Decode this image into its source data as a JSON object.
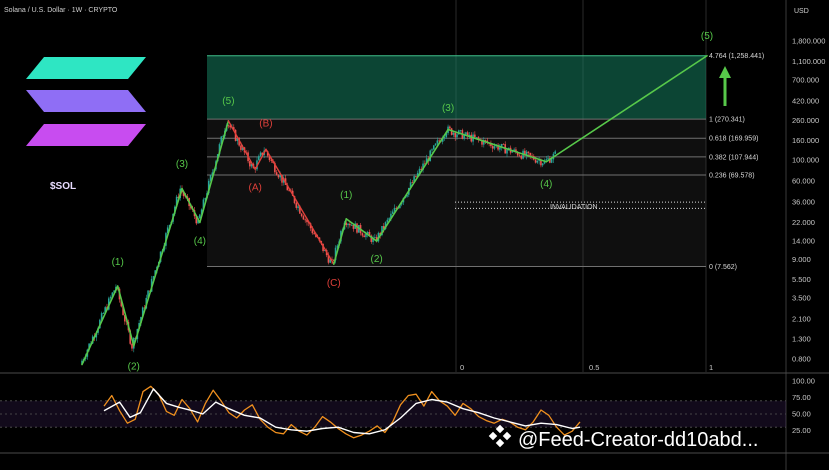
{
  "header": {
    "title": "Solana / U.S. Dollar · 1W · CRYPTO",
    "currency": "USD"
  },
  "branding": {
    "ticker_label": "$SOL",
    "logo": "solana-logo",
    "stripe_colors": [
      "#2ee6c3",
      "#8f6ef5",
      "#c84cf0"
    ]
  },
  "watermark": {
    "text": "@Feed-Creator-dd10abd...",
    "icon": "binance-icon"
  },
  "colors": {
    "wave": "#57c84a",
    "corrective": "#e0403a",
    "candle_up": "#26a69a",
    "candle_down": "#ef5350",
    "rsi": "#f0901e",
    "rsi_ma": "#ffffff"
  },
  "chart_data": [
    {
      "type": "candlestick",
      "scale": "log",
      "y_axis": {
        "ticks": [
          "1,800.000",
          "1,100.000",
          "700.000",
          "420.000",
          "260.000",
          "160.000",
          "100.000",
          "60.000",
          "36.000",
          "22.000",
          "14.000",
          "9.000",
          "5.500",
          "3.500",
          "2.100",
          "1.300",
          "0.800"
        ]
      },
      "fib_levels": [
        {
          "label": "4.764 (1,258.441)",
          "value": 1258.441
        },
        {
          "label": "1 (270.341)",
          "value": 270.341
        },
        {
          "label": "0.618 (169.959)",
          "value": 169.959
        },
        {
          "label": "0.382 (107.944)",
          "value": 107.944
        },
        {
          "label": "0.236 (69.578)",
          "value": 69.578
        },
        {
          "label": "0 (7.562)",
          "value": 7.562
        }
      ],
      "invalidation": {
        "label": "INVALIDATION",
        "upper": 36,
        "lower": 31
      },
      "elliott_path": [
        {
          "date": "2020-04-13",
          "value": 0.7
        },
        {
          "date": "2020-08-31",
          "value": 4.7
        },
        {
          "date": "2020-11-02",
          "value": 1.1
        },
        {
          "date": "2021-05-10",
          "value": 50
        },
        {
          "date": "2021-07-19",
          "value": 22
        },
        {
          "date": "2021-11-08",
          "value": 259
        },
        {
          "date": "2022-02-21",
          "value": 80
        },
        {
          "date": "2022-04-04",
          "value": 130
        },
        {
          "date": "2022-12-26",
          "value": 8
        },
        {
          "date": "2023-02-13",
          "value": 24
        },
        {
          "date": "2023-06-12",
          "value": 14
        },
        {
          "date": "2024-03-18",
          "value": 210
        },
        {
          "date": "2025-04-07",
          "value": 96
        },
        {
          "date": "2026-12-28",
          "value": 1258
        }
      ],
      "wave_labels": [
        {
          "text": "(1)",
          "date": "2020-08-31",
          "value": 7.8,
          "color": "wave"
        },
        {
          "text": "(2)",
          "date": "2020-11-02",
          "value": 0.62,
          "color": "wave"
        },
        {
          "text": "(3)",
          "date": "2021-05-10",
          "value": 85,
          "color": "wave"
        },
        {
          "text": "(4)",
          "date": "2021-07-19",
          "value": 13,
          "color": "wave"
        },
        {
          "text": "(5)",
          "date": "2021-11-08",
          "value": 390,
          "color": "wave"
        },
        {
          "text": "(A)",
          "date": "2022-02-21",
          "value": 48,
          "color": "corrective"
        },
        {
          "text": "(B)",
          "date": "2022-04-04",
          "value": 225,
          "color": "corrective"
        },
        {
          "text": "(C)",
          "date": "2022-12-26",
          "value": 4.7,
          "color": "corrective"
        },
        {
          "text": "(1)",
          "date": "2023-02-13",
          "value": 40,
          "color": "wave"
        },
        {
          "text": "(2)",
          "date": "2023-06-12",
          "value": 8.4,
          "color": "wave"
        },
        {
          "text": "(3)",
          "date": "2024-03-18",
          "value": 330,
          "color": "wave"
        },
        {
          "text": "(4)",
          "date": "2025-04-07",
          "value": 52,
          "color": "wave"
        },
        {
          "text": "(5)",
          "date": "2026-12-28",
          "value": 1900,
          "color": "wave"
        }
      ],
      "x_ticks": [
        "0",
        "0.5",
        "1"
      ]
    },
    {
      "type": "line",
      "name_ticks": [
        "100.00",
        "75.00",
        "50.00",
        "25.00"
      ],
      "ylim": [
        0,
        100
      ],
      "series": [
        {
          "key": "rsi",
          "points": [
            [
              0,
              62
            ],
            [
              3,
              78
            ],
            [
              6,
              55
            ],
            [
              9,
              36
            ],
            [
              12,
              42
            ],
            [
              15,
              84
            ],
            [
              18,
              92
            ],
            [
              21,
              80
            ],
            [
              24,
              54
            ],
            [
              27,
              48
            ],
            [
              30,
              72
            ],
            [
              33,
              58
            ],
            [
              36,
              38
            ],
            [
              39,
              66
            ],
            [
              42,
              86
            ],
            [
              45,
              70
            ],
            [
              48,
              52
            ],
            [
              51,
              44
            ],
            [
              54,
              56
            ],
            [
              57,
              64
            ],
            [
              60,
              42
            ],
            [
              63,
              30
            ],
            [
              66,
              22
            ],
            [
              69,
              20
            ],
            [
              72,
              34
            ],
            [
              75,
              24
            ],
            [
              78,
              18
            ],
            [
              81,
              30
            ],
            [
              84,
              46
            ],
            [
              87,
              38
            ],
            [
              90,
              28
            ],
            [
              93,
              20
            ],
            [
              96,
              14
            ],
            [
              99,
              18
            ],
            [
              102,
              24
            ],
            [
              105,
              32
            ],
            [
              108,
              22
            ],
            [
              111,
              38
            ],
            [
              114,
              64
            ],
            [
              117,
              78
            ],
            [
              120,
              80
            ],
            [
              123,
              62
            ],
            [
              126,
              84
            ],
            [
              129,
              70
            ],
            [
              132,
              62
            ],
            [
              135,
              48
            ],
            [
              138,
              66
            ],
            [
              141,
              58
            ],
            [
              144,
              46
            ],
            [
              147,
              40
            ],
            [
              150,
              36
            ],
            [
              153,
              42
            ],
            [
              156,
              38
            ],
            [
              159,
              30
            ],
            [
              162,
              26
            ],
            [
              165,
              38
            ],
            [
              168,
              56
            ],
            [
              171,
              48
            ],
            [
              174,
              30
            ],
            [
              177,
              18
            ],
            [
              180,
              24
            ],
            [
              183,
              38
            ]
          ]
        },
        {
          "key": "rsi_ma",
          "points": [
            [
              0,
              55
            ],
            [
              6,
              68
            ],
            [
              10,
              45
            ],
            [
              14,
              52
            ],
            [
              19,
              88
            ],
            [
              24,
              66
            ],
            [
              29,
              60
            ],
            [
              34,
              55
            ],
            [
              38,
              50
            ],
            [
              43,
              68
            ],
            [
              48,
              58
            ],
            [
              54,
              48
            ],
            [
              60,
              44
            ],
            [
              66,
              30
            ],
            [
              72,
              26
            ],
            [
              78,
              24
            ],
            [
              84,
              28
            ],
            [
              90,
              30
            ],
            [
              96,
              22
            ],
            [
              102,
              20
            ],
            [
              108,
              26
            ],
            [
              114,
              44
            ],
            [
              120,
              66
            ],
            [
              126,
              72
            ],
            [
              132,
              68
            ],
            [
              138,
              58
            ],
            [
              144,
              52
            ],
            [
              150,
              44
            ],
            [
              156,
              38
            ],
            [
              162,
              32
            ],
            [
              168,
              36
            ],
            [
              174,
              34
            ],
            [
              180,
              28
            ],
            [
              183,
              30
            ]
          ]
        }
      ]
    }
  ]
}
